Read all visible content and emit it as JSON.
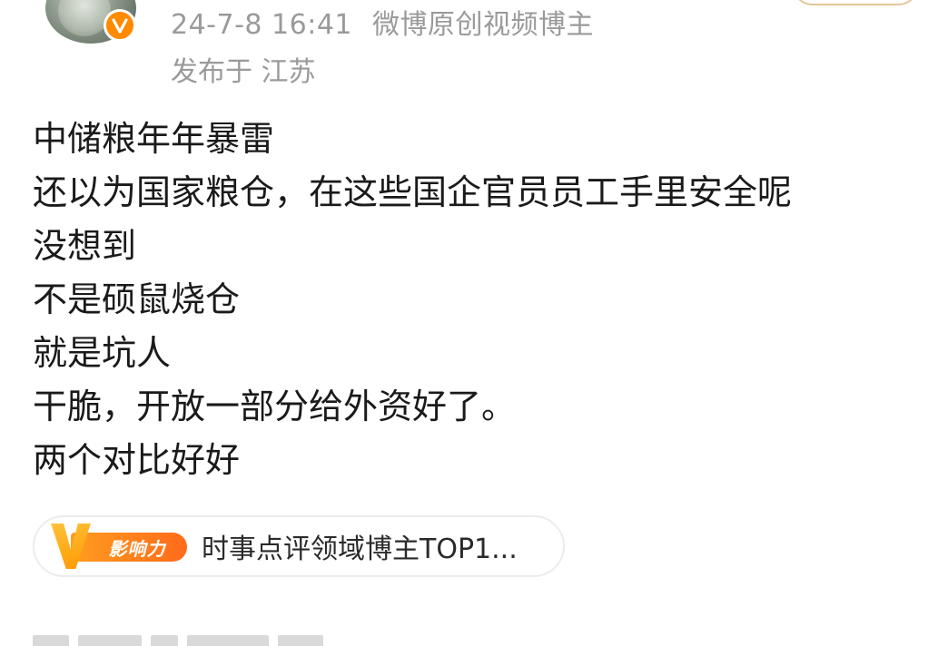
{
  "post": {
    "author": {
      "avatar_icon": "avatar-image",
      "verified_icon": "verified-v-icon",
      "verified_color": "#ff8a00"
    },
    "meta": {
      "timestamp": "24-7-8 16:41",
      "author_role": "微博原创视频博主",
      "location": "发布于 江苏"
    },
    "content_lines": [
      "中储粮年年暴雷",
      "还以为国家粮仓，在这些国企官员员工手里安全呢",
      "没想到",
      "不是硕鼠烧仓",
      "就是坑人",
      "干脆，开放一部分给外资好了。",
      "两个对比好好"
    ],
    "influence": {
      "badge_v": "V",
      "badge_label": "影响力",
      "text": "时事点评领域博主TOP1...",
      "badge_color": "#ff7a1a"
    }
  }
}
